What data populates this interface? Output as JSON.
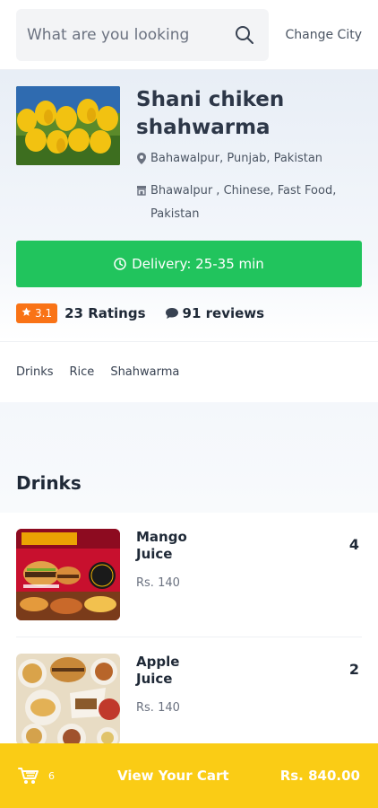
{
  "header": {
    "search_placeholder": "What are you looking",
    "change_city": "Change City"
  },
  "restaurant": {
    "name": "Shani chiken shahwarma",
    "location": "Bahawalpur, Punjab, Pakistan",
    "cuisine": "Bhawalpur , Chinese, Fast Food, Pakistan",
    "delivery": "Delivery: 25-35 min",
    "rating": "3.1",
    "ratings_count": "23 Ratings",
    "reviews_count": "91 reviews"
  },
  "categories": [
    "Drinks",
    "Rice",
    "Shahwarma"
  ],
  "section": {
    "title": "Drinks"
  },
  "items": [
    {
      "name": "Mango Juice",
      "price": "Rs. 140",
      "qty": "4"
    },
    {
      "name": "Apple Juice",
      "price": "Rs. 140",
      "qty": "2"
    }
  ],
  "cart": {
    "count": "6",
    "label": "View Your Cart",
    "total": "Rs. 840.00"
  },
  "colors": {
    "delivery_green": "#21c45d",
    "rating_orange": "#f97316",
    "cart_yellow": "#facc15"
  }
}
